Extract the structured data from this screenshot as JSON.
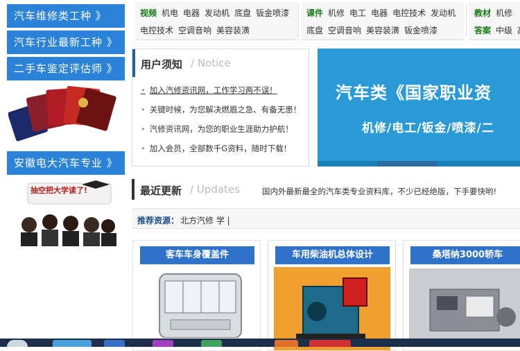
{
  "sidebar": {
    "buttons": [
      "汽车维修类工种 》",
      "汽车行业最新工种 》",
      "二手车鉴定评估师 》"
    ],
    "bottom_button": "安徽电大汽车专业 》",
    "students_text": "抽空把大学读了!"
  },
  "categories": [
    {
      "rows": [
        [
          "视频",
          "机电",
          "电器",
          "发动机",
          "底盘",
          "钣金喷漆"
        ],
        [
          "电控技术",
          "空调音响",
          "美容装潢"
        ]
      ]
    },
    {
      "rows": [
        [
          "课件",
          "机修",
          "电工",
          "电器",
          "电控技术",
          "发动机"
        ],
        [
          "底盘",
          "空调音响",
          "美容装潢",
          "钣金喷漆"
        ]
      ]
    },
    {
      "rows": [
        [
          "教材",
          "机修"
        ],
        [
          "答案",
          "中级",
          "高"
        ]
      ]
    }
  ],
  "notice": {
    "title": "用户须知",
    "title_en": "/ Notice",
    "items": [
      "加入汽修资讯网，工作学习两不误！",
      "关键时候，为您解决燃眉之急、有备无患！",
      "汽修资讯网，为您的职业生涯助力护航！",
      "加入会员，全部数千G资料，随时下载！"
    ]
  },
  "banner": {
    "line1": "汽车类《国家职业资",
    "line2": "机修/电工/钣金/喷漆/二"
  },
  "updates": {
    "title": "最近更新",
    "title_en": "/ Updates",
    "desc": "国内外最新最全的汽车类专业资料库，不少已经绝版，下手要快哟!"
  },
  "recommend": {
    "label": "推荐资源：",
    "value": "北方汽修 学 |"
  },
  "cards": [
    "客车车身覆盖件",
    "车用柴油机总体设计",
    "桑塔纳3000轿车"
  ],
  "colors": {
    "accent": "#2b82d9",
    "banner": "#2a9ad6",
    "card_title": "#2f72c9"
  }
}
